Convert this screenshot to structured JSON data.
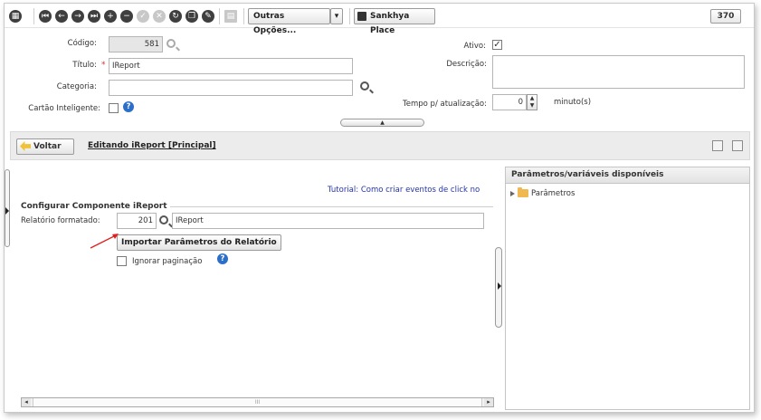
{
  "toolbar": {
    "more_options_label": "Outras Opções...",
    "place_label": "Sankhya Place",
    "record_count": "370"
  },
  "header": {
    "codigo_label": "Código:",
    "codigo_value": "581",
    "titulo_label": "Título:",
    "titulo_required": "*",
    "titulo_value": "IReport",
    "categoria_label": "Categoria:",
    "categoria_value": "",
    "cartao_label": "Cartão Inteligente:",
    "ativo_label": "Ativo:",
    "ativo_checked": "✓",
    "descricao_label": "Descrição:",
    "descricao_value": "",
    "tempo_label": "Tempo p/ atualização:",
    "tempo_value": "0",
    "tempo_unit": "minuto(s)",
    "collapse_glyph": "▲"
  },
  "breadcrumb": {
    "back_label": "Voltar",
    "title": "Editando iReport [Principal]"
  },
  "editor": {
    "tutorial_link": "Tutorial: Como criar eventos de click no",
    "section_title": "Configurar Componente iReport",
    "relatorio_label": "Relatório formatado:",
    "relatorio_code": "201",
    "relatorio_name": "IReport",
    "import_button": "Importar Parâmetros do Relatório",
    "ignorar_label": "Ignorar paginação",
    "scroll_grip": "III"
  },
  "params_panel": {
    "title": "Parâmetros/variáveis disponíveis",
    "tree": [
      {
        "label": "Parâmetros"
      }
    ]
  },
  "colors": {
    "link": "#2233aa",
    "help_icon": "#2c6fc9",
    "annotation_arrow": "#e02020",
    "folder": "#f0b851"
  }
}
